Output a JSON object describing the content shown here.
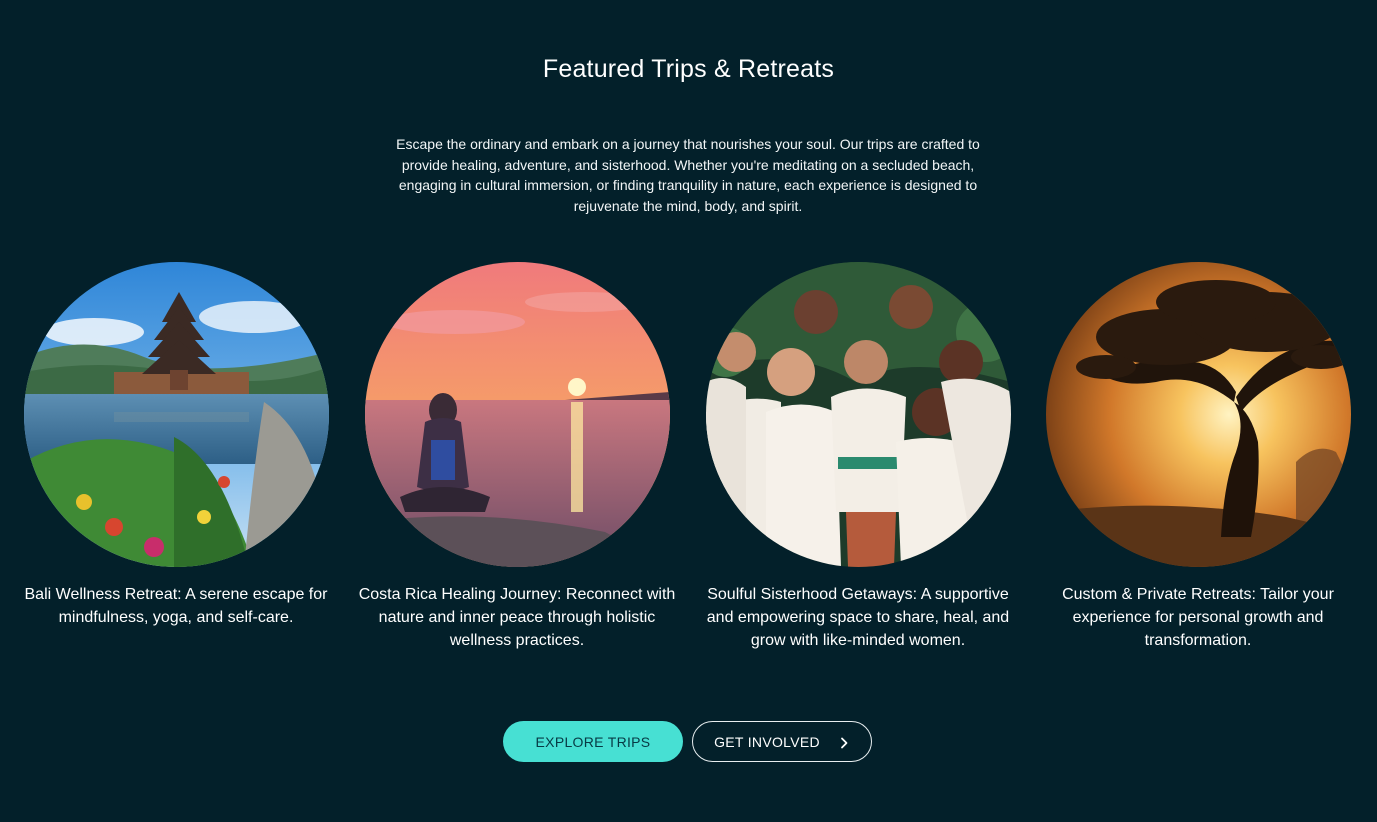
{
  "section": {
    "title": "Featured Trips & Retreats",
    "intro": "Escape the ordinary and embark on a journey that nourishes your soul. Our trips are crafted to provide healing, adventure, and sisterhood. Whether you're meditating on a secluded beach, engaging in cultural immersion, or finding tranquility in nature, each experience is designed to rejuvenate the mind, body, and spirit."
  },
  "cards": [
    {
      "caption": "Bali Wellness Retreat: A serene escape for mindfulness, yoga, and self-care.",
      "image": "bali-temple-lake-photo"
    },
    {
      "caption": "Costa Rica Healing Journey: Reconnect with nature and inner peace through holistic wellness practices.",
      "image": "sunset-meditation-photo"
    },
    {
      "caption": "Soulful Sisterhood Getaways: A supportive and empowering space to share, heal, and grow with like-minded women.",
      "image": "group-of-women-photo"
    },
    {
      "caption": "Custom & Private Retreats: Tailor your experience for personal growth and transformation.",
      "image": "tree-sunset-photo"
    }
  ],
  "buttons": {
    "explore": "EXPLORE TRIPS",
    "involved": "GET INVOLVED"
  },
  "colors": {
    "background": "#03202a",
    "accent": "#47e0d3",
    "text": "#ffffff"
  }
}
